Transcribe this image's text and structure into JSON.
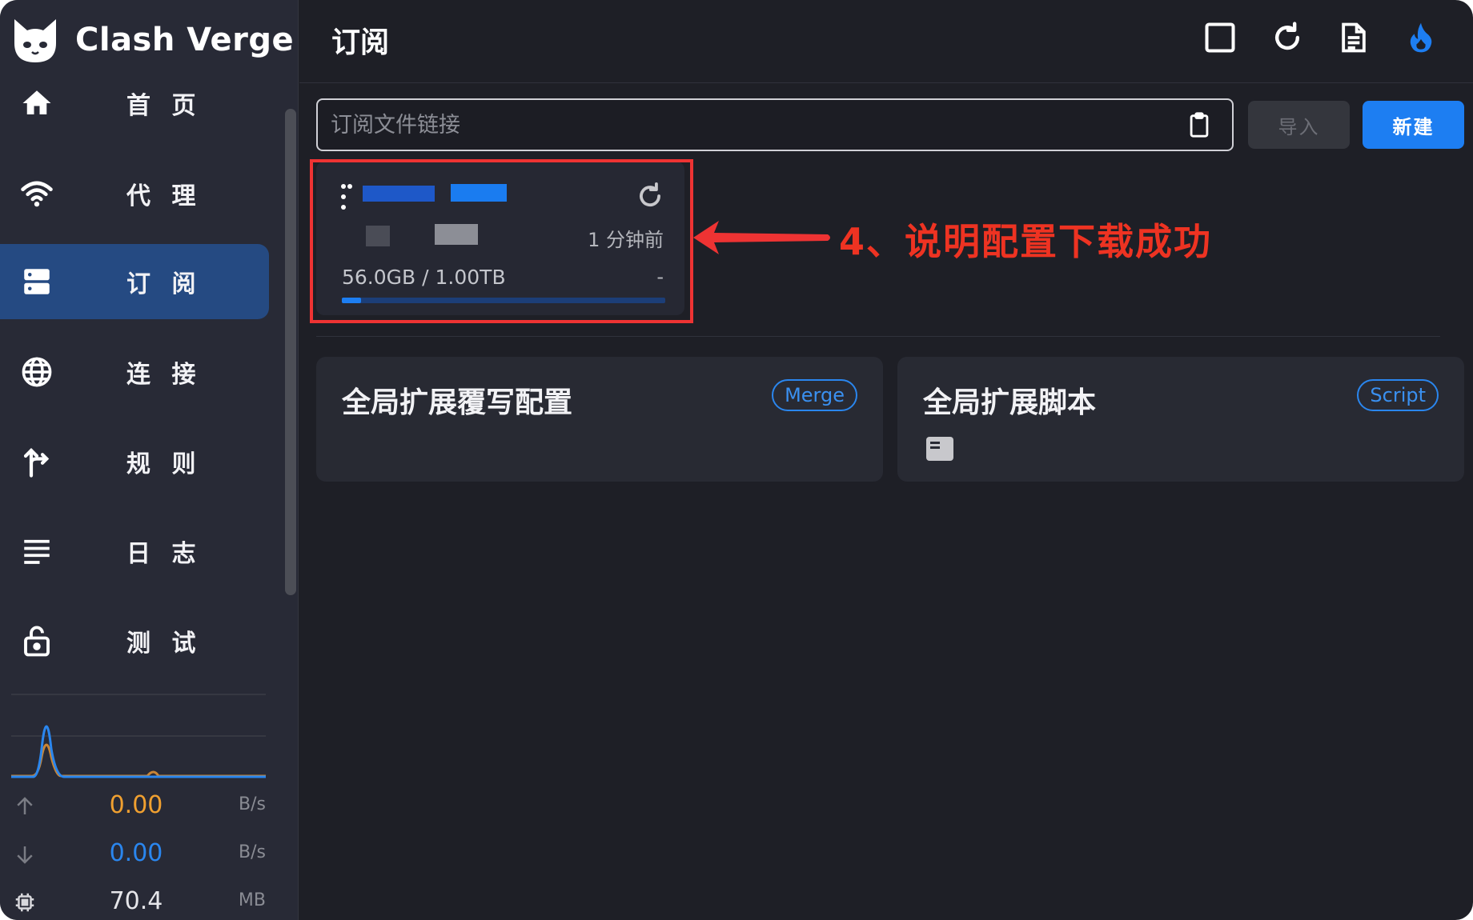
{
  "app": {
    "name": "Clash Verge"
  },
  "sidebar": {
    "items": [
      {
        "label": "首 页",
        "icon": "home-icon"
      },
      {
        "label": "代 理",
        "icon": "wifi-icon"
      },
      {
        "label": "订 阅",
        "icon": "server-icon",
        "active": true
      },
      {
        "label": "连 接",
        "icon": "globe-icon"
      },
      {
        "label": "规 则",
        "icon": "fork-icon"
      },
      {
        "label": "日 志",
        "icon": "list-icon"
      },
      {
        "label": "测 试",
        "icon": "lock-icon"
      }
    ],
    "traffic": {
      "upload": {
        "value": "0.00",
        "unit": "B/s"
      },
      "download": {
        "value": "0.00",
        "unit": "B/s"
      },
      "memory": {
        "value": "70.4",
        "unit": "MB"
      }
    }
  },
  "header": {
    "title": "订阅",
    "icons": [
      "square-icon",
      "refresh-icon",
      "document-icon",
      "flame-icon"
    ]
  },
  "import_bar": {
    "placeholder": "订阅文件链接",
    "import_label": "导入",
    "new_label": "新建"
  },
  "profile": {
    "updated": "1 分钟前",
    "usage": "56.0GB / 1.00TB",
    "expire": "-",
    "usage_fraction": 0.06
  },
  "annotation": {
    "text": "4、说明配置下载成功"
  },
  "extensions": [
    {
      "title": "全局扩展覆写配置",
      "tag": "Merge"
    },
    {
      "title": "全局扩展脚本",
      "tag": "Script"
    }
  ],
  "colors": {
    "accent": "#1d7ef2",
    "upload": "#f0a030",
    "download": "#2a86ee",
    "annotation": "#ee3333"
  }
}
